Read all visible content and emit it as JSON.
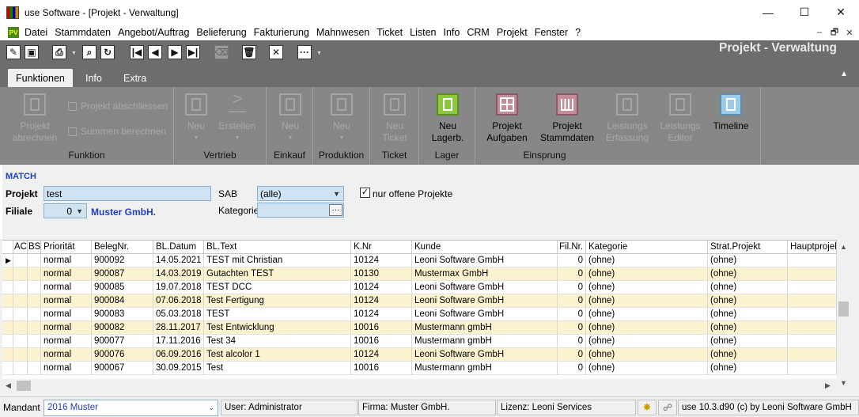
{
  "window": {
    "title": "use Software - [Projekt - Verwaltung]",
    "minimize": "—",
    "maximize": "☐",
    "close": "✕"
  },
  "menu": {
    "logo": "PV",
    "items": [
      "Datei",
      "Stammdaten",
      "Angebot/Auftrag",
      "Belieferung",
      "Fakturierung",
      "Mahnwesen",
      "Ticket",
      "Listen",
      "Info",
      "CRM",
      "Projekt",
      "Fenster",
      "?"
    ],
    "mdi": [
      "–",
      "🗗",
      "✕"
    ]
  },
  "toolbar": {
    "view_title": "Projekt - Verwaltung"
  },
  "ribbon": {
    "tabs": [
      "Funktionen",
      "Info",
      "Extra"
    ],
    "groups": {
      "funktion": {
        "label": "Funktion",
        "main_line1": "Projekt",
        "main_line2": "abrechnen",
        "small1": "Projekt abschliessen",
        "small2": "Summen berechnen"
      },
      "vertrieb": {
        "label": "Vertrieb",
        "neu": "Neu",
        "erstellen": "Erstellen"
      },
      "einkauf": {
        "label": "Einkauf",
        "neu": "Neu"
      },
      "produktion": {
        "label": "Produktion",
        "neu": "Neu"
      },
      "ticket": {
        "label": "Ticket",
        "line1": "Neu",
        "line2": "Ticket"
      },
      "lager": {
        "label": "Lager",
        "line1": "Neu",
        "line2": "Lagerb."
      },
      "einsprung": {
        "label": "Einsprung",
        "aufgaben_1": "Projekt",
        "aufgaben_2": "Aufgaben",
        "stammdaten_1": "Projekt",
        "stammdaten_2": "Stammdaten",
        "erfassung_1": "Leistungs",
        "erfassung_2": "Erfassung",
        "editor_1": "Leistungs",
        "editor_2": "Editor",
        "timeline": "Timeline"
      }
    },
    "colors": {
      "lager": "#8dc63f",
      "projekt": "#c48e99",
      "timeline": "#9ccbe8"
    }
  },
  "filter": {
    "match_label": "MATCH",
    "projekt_label": "Projekt",
    "projekt_value": "test",
    "filiale_label": "Filiale",
    "filiale_value": "0",
    "filiale_name": "Muster GmbH.",
    "sab_label": "SAB",
    "sab_value": "(alle)",
    "kategorie_label": "Kategorie",
    "kategorie_value": "",
    "nur_offene_label": "nur offene Projekte",
    "nur_offene_checked": "✓",
    "ellipsis": "···"
  },
  "grid": {
    "columns": [
      "",
      "AC",
      "BS",
      "Priorität",
      "BelegNr.",
      "BL.Datum",
      "BL.Text",
      "K.Nr",
      "Kunde",
      "Fil.Nr.",
      "Kategorie",
      "Strat.Projekt",
      "Hauptprojekt"
    ],
    "rows": [
      [
        "normal",
        "900092",
        "14.05.2021",
        "TEST mit Christian",
        "10124",
        "Leoni Software GmbH",
        "0",
        "(ohne)",
        "(ohne)"
      ],
      [
        "normal",
        "900087",
        "14.03.2019",
        "Gutachten TEST",
        "10130",
        "Mustermax GmbH",
        "0",
        "(ohne)",
        "(ohne)"
      ],
      [
        "normal",
        "900085",
        "19.07.2018",
        "TEST DCC",
        "10124",
        "Leoni Software GmbH",
        "0",
        "(ohne)",
        "(ohne)"
      ],
      [
        "normal",
        "900084",
        "07.06.2018",
        "Test Fertigung",
        "10124",
        "Leoni Software GmbH",
        "0",
        "(ohne)",
        "(ohne)"
      ],
      [
        "normal",
        "900083",
        "05.03.2018",
        "TEST",
        "10124",
        "Leoni Software GmbH",
        "0",
        "(ohne)",
        "(ohne)"
      ],
      [
        "normal",
        "900082",
        "28.11.2017",
        "Test Entwicklung",
        "10016",
        "Mustermann gmbH",
        "0",
        "(ohne)",
        "(ohne)"
      ],
      [
        "normal",
        "900077",
        "17.11.2016",
        "Test 34",
        "10016",
        "Mustermann gmbH",
        "0",
        "(ohne)",
        "(ohne)"
      ],
      [
        "normal",
        "900076",
        "06.09.2016",
        "Test alcolor 1",
        "10124",
        "Leoni Software GmbH",
        "0",
        "(ohne)",
        "(ohne)"
      ],
      [
        "normal",
        "900067",
        "30.09.2015",
        "Test",
        "10016",
        "Mustermann gmbH",
        "0",
        "(ohne)",
        "(ohne)"
      ]
    ]
  },
  "status": {
    "mandant_label": "Mandant",
    "mandant_value": "2016 Muster",
    "user": "User: Administrator",
    "firma": "Firma: Muster GmbH.",
    "lizenz": "Lizenz: Leoni Services",
    "version": "use 10.3.d90 (c) by Leoni Software GmbH"
  }
}
